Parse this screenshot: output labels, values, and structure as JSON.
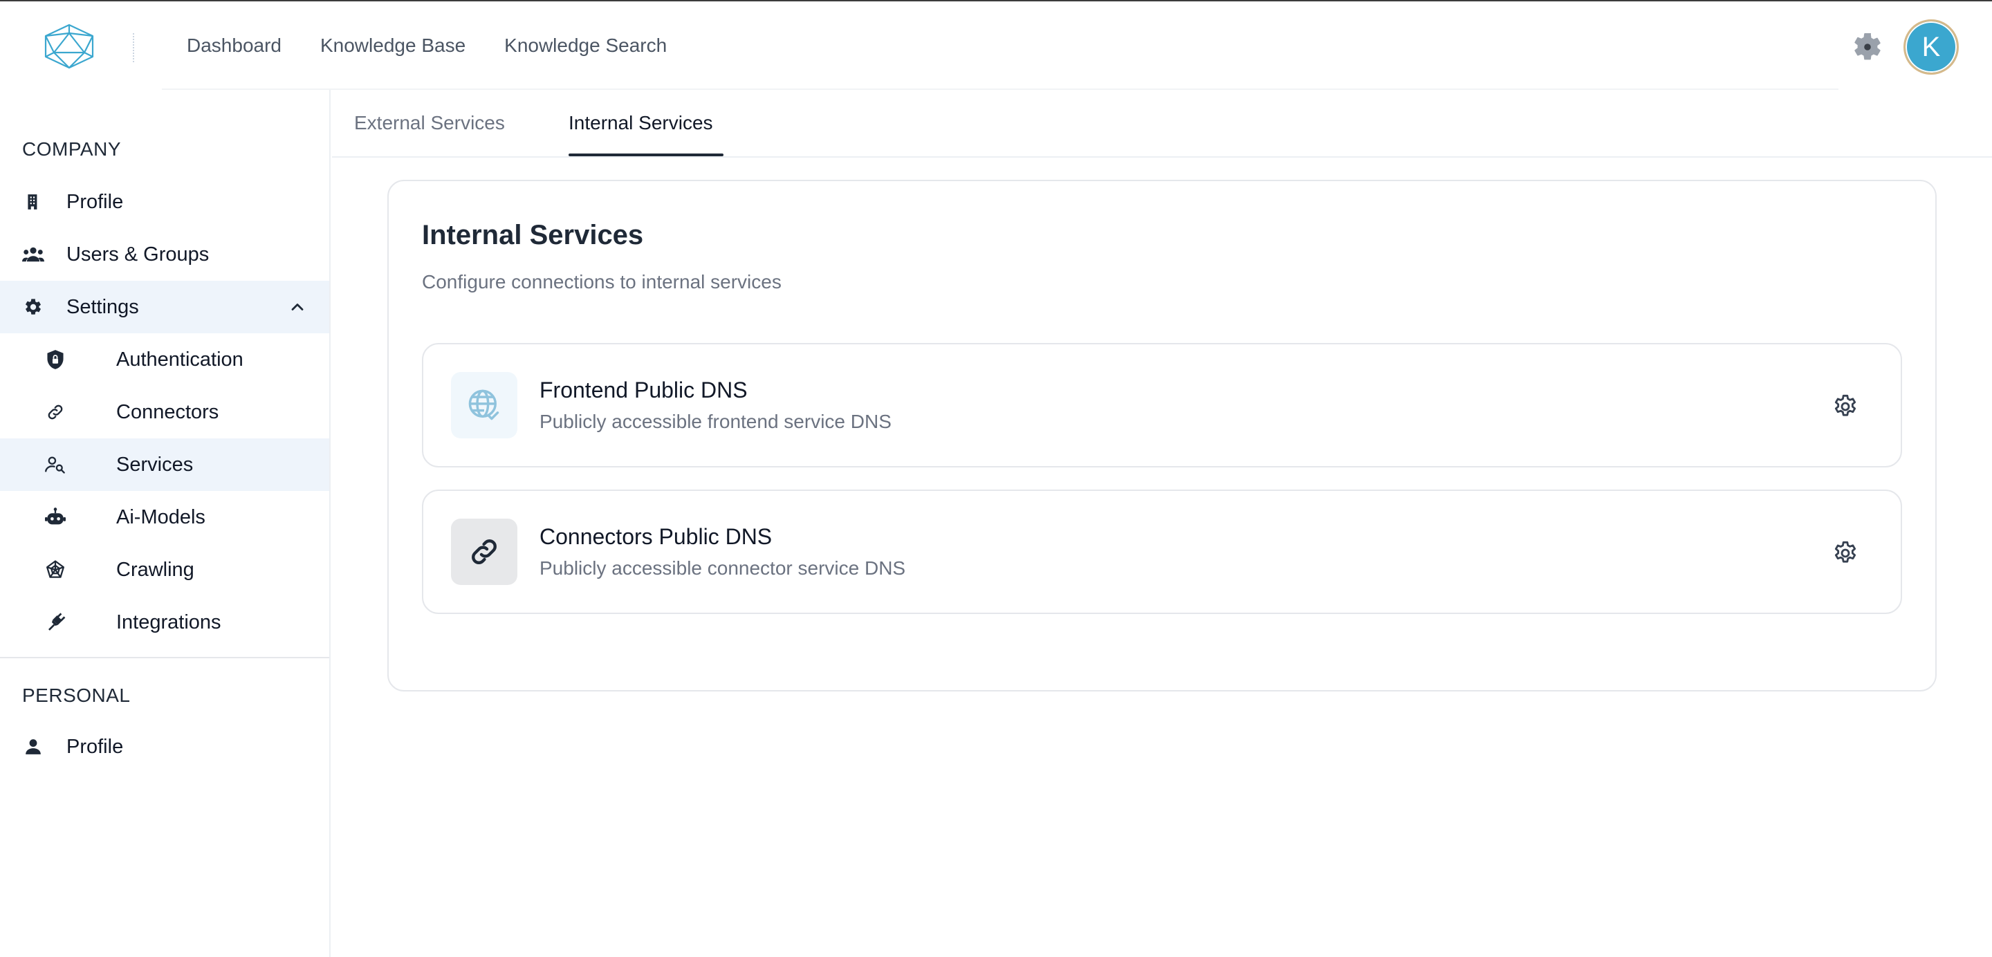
{
  "header": {
    "nav": [
      "Dashboard",
      "Knowledge Base",
      "Knowledge Search"
    ],
    "avatar_initial": "K",
    "logo_icon": "icosahedron-logo-icon",
    "settings_icon": "gear-icon"
  },
  "sidebar": {
    "company_title": "COMPANY",
    "company_items": [
      {
        "label": "Profile",
        "icon": "building-icon"
      },
      {
        "label": "Users & Groups",
        "icon": "users-icon"
      },
      {
        "label": "Settings",
        "icon": "gear-icon",
        "expanded": true
      }
    ],
    "settings_items": [
      {
        "label": "Authentication",
        "icon": "shield-lock-icon"
      },
      {
        "label": "Connectors",
        "icon": "link-icon"
      },
      {
        "label": "Services",
        "icon": "person-search-icon",
        "active": true
      },
      {
        "label": "Ai-Models",
        "icon": "robot-icon"
      },
      {
        "label": "Crawling",
        "icon": "spider-web-icon"
      },
      {
        "label": "Integrations",
        "icon": "plug-icon"
      }
    ],
    "personal_title": "PERSONAL",
    "personal_items": [
      {
        "label": "Profile",
        "icon": "person-icon"
      }
    ]
  },
  "tabs": [
    {
      "label": "External Services",
      "active": false
    },
    {
      "label": "Internal Services",
      "active": true
    }
  ],
  "card": {
    "title": "Internal Services",
    "subtitle": "Configure connections to internal services",
    "services": [
      {
        "name": "Frontend Public DNS",
        "description": "Publicly accessible frontend service DNS",
        "icon": "globe-check-icon"
      },
      {
        "name": "Connectors Public DNS",
        "description": "Publicly accessible connector service DNS",
        "icon": "link-icon"
      }
    ]
  },
  "colors": {
    "accent": "#3ba7cf",
    "active_bg": "#eef4fb",
    "text_primary": "#111827",
    "text_muted": "#6b7280"
  }
}
